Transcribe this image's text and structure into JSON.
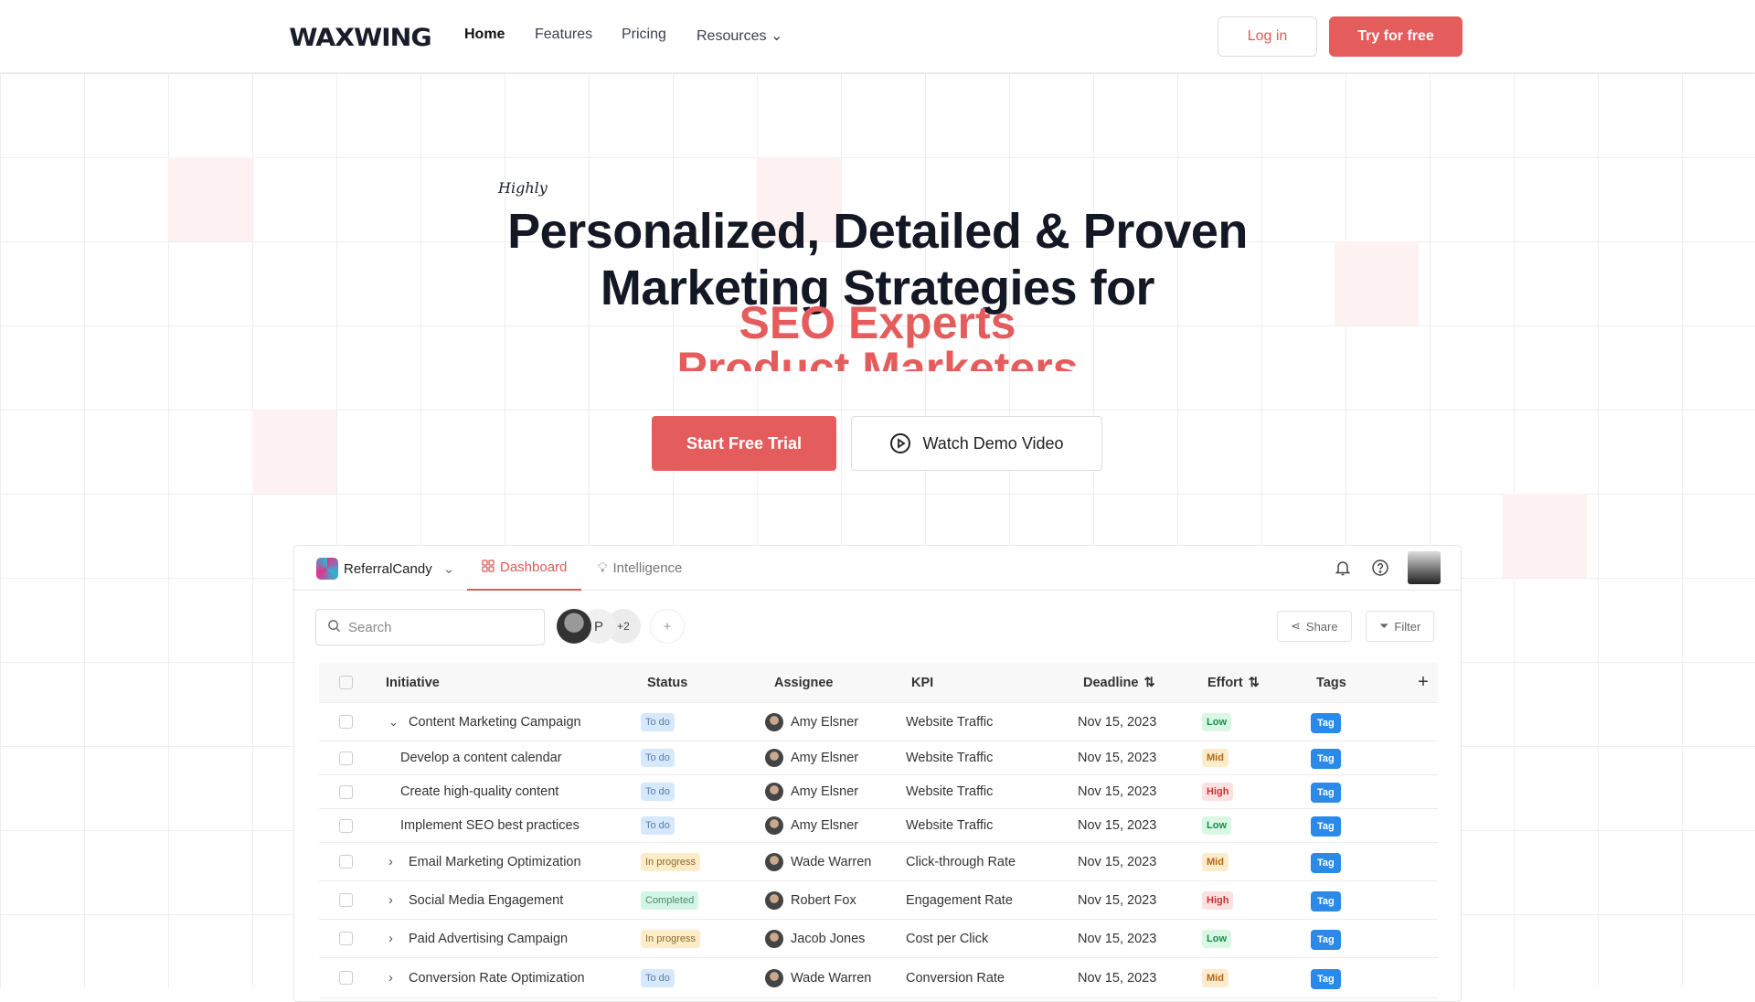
{
  "nav": {
    "logo": "WAXWING",
    "links": [
      "Home",
      "Features",
      "Pricing",
      "Resources"
    ],
    "login": "Log in",
    "try": "Try for free"
  },
  "hero": {
    "eyebrow": "Highly",
    "line1": "Personalized, Detailed & Proven",
    "line2": "Marketing Strategies for",
    "rotating": [
      "SEO Experts",
      "Product Marketers"
    ],
    "start": "Start Free Trial",
    "watch": "Watch Demo Video"
  },
  "app": {
    "workspace": "ReferralCandy",
    "tabs": [
      "Dashboard",
      "Intelligence"
    ],
    "search_placeholder": "Search",
    "avatar_p": "P",
    "avatar_more": "+2",
    "share": "Share",
    "filter": "Filter",
    "columns": [
      "Initiative",
      "Status",
      "Assignee",
      "KPI",
      "Deadline",
      "Effort",
      "Tags"
    ],
    "rows": [
      {
        "initiative": "Content Marketing Campaign",
        "status": "To do",
        "assignee": "Amy Elsner",
        "kpi": "Website Traffic",
        "deadline": "Nov 15, 2023",
        "effort": "Low",
        "tag": "Tag",
        "toggle": "expanded"
      },
      {
        "initiative": "Develop a content calendar",
        "status": "To do",
        "assignee": "Amy Elsner",
        "kpi": "Website Traffic",
        "deadline": "Nov 15, 2023",
        "effort": "Mid",
        "tag": "Tag",
        "toggle": "child"
      },
      {
        "initiative": "Create high-quality content",
        "status": "To do",
        "assignee": "Amy Elsner",
        "kpi": "Website Traffic",
        "deadline": "Nov 15, 2023",
        "effort": "High",
        "tag": "Tag",
        "toggle": "child"
      },
      {
        "initiative": "Implement SEO best practices",
        "status": "To do",
        "assignee": "Amy Elsner",
        "kpi": "Website Traffic",
        "deadline": "Nov 15, 2023",
        "effort": "Low",
        "tag": "Tag",
        "toggle": "child"
      },
      {
        "initiative": "Email Marketing Optimization",
        "status": "In progress",
        "assignee": "Wade Warren",
        "kpi": "Click-through Rate",
        "deadline": "Nov 15, 2023",
        "effort": "Mid",
        "tag": "Tag",
        "toggle": "collapsed"
      },
      {
        "initiative": "Social Media Engagement",
        "status": "Completed",
        "assignee": "Robert Fox",
        "kpi": "Engagement Rate",
        "deadline": "Nov 15, 2023",
        "effort": "High",
        "tag": "Tag",
        "toggle": "collapsed"
      },
      {
        "initiative": "Paid Advertising Campaign",
        "status": "In progress",
        "assignee": "Jacob Jones",
        "kpi": "Cost per Click",
        "deadline": "Nov 15, 2023",
        "effort": "Low",
        "tag": "Tag",
        "toggle": "collapsed"
      },
      {
        "initiative": "Conversion Rate Optimization",
        "status": "To do",
        "assignee": "Wade Warren",
        "kpi": "Conversion Rate",
        "deadline": "Nov 15, 2023",
        "effort": "Mid",
        "tag": "Tag",
        "toggle": "collapsed"
      }
    ]
  },
  "colors": {
    "accent": "#e55c5c",
    "tag": "#2b8ae8"
  }
}
